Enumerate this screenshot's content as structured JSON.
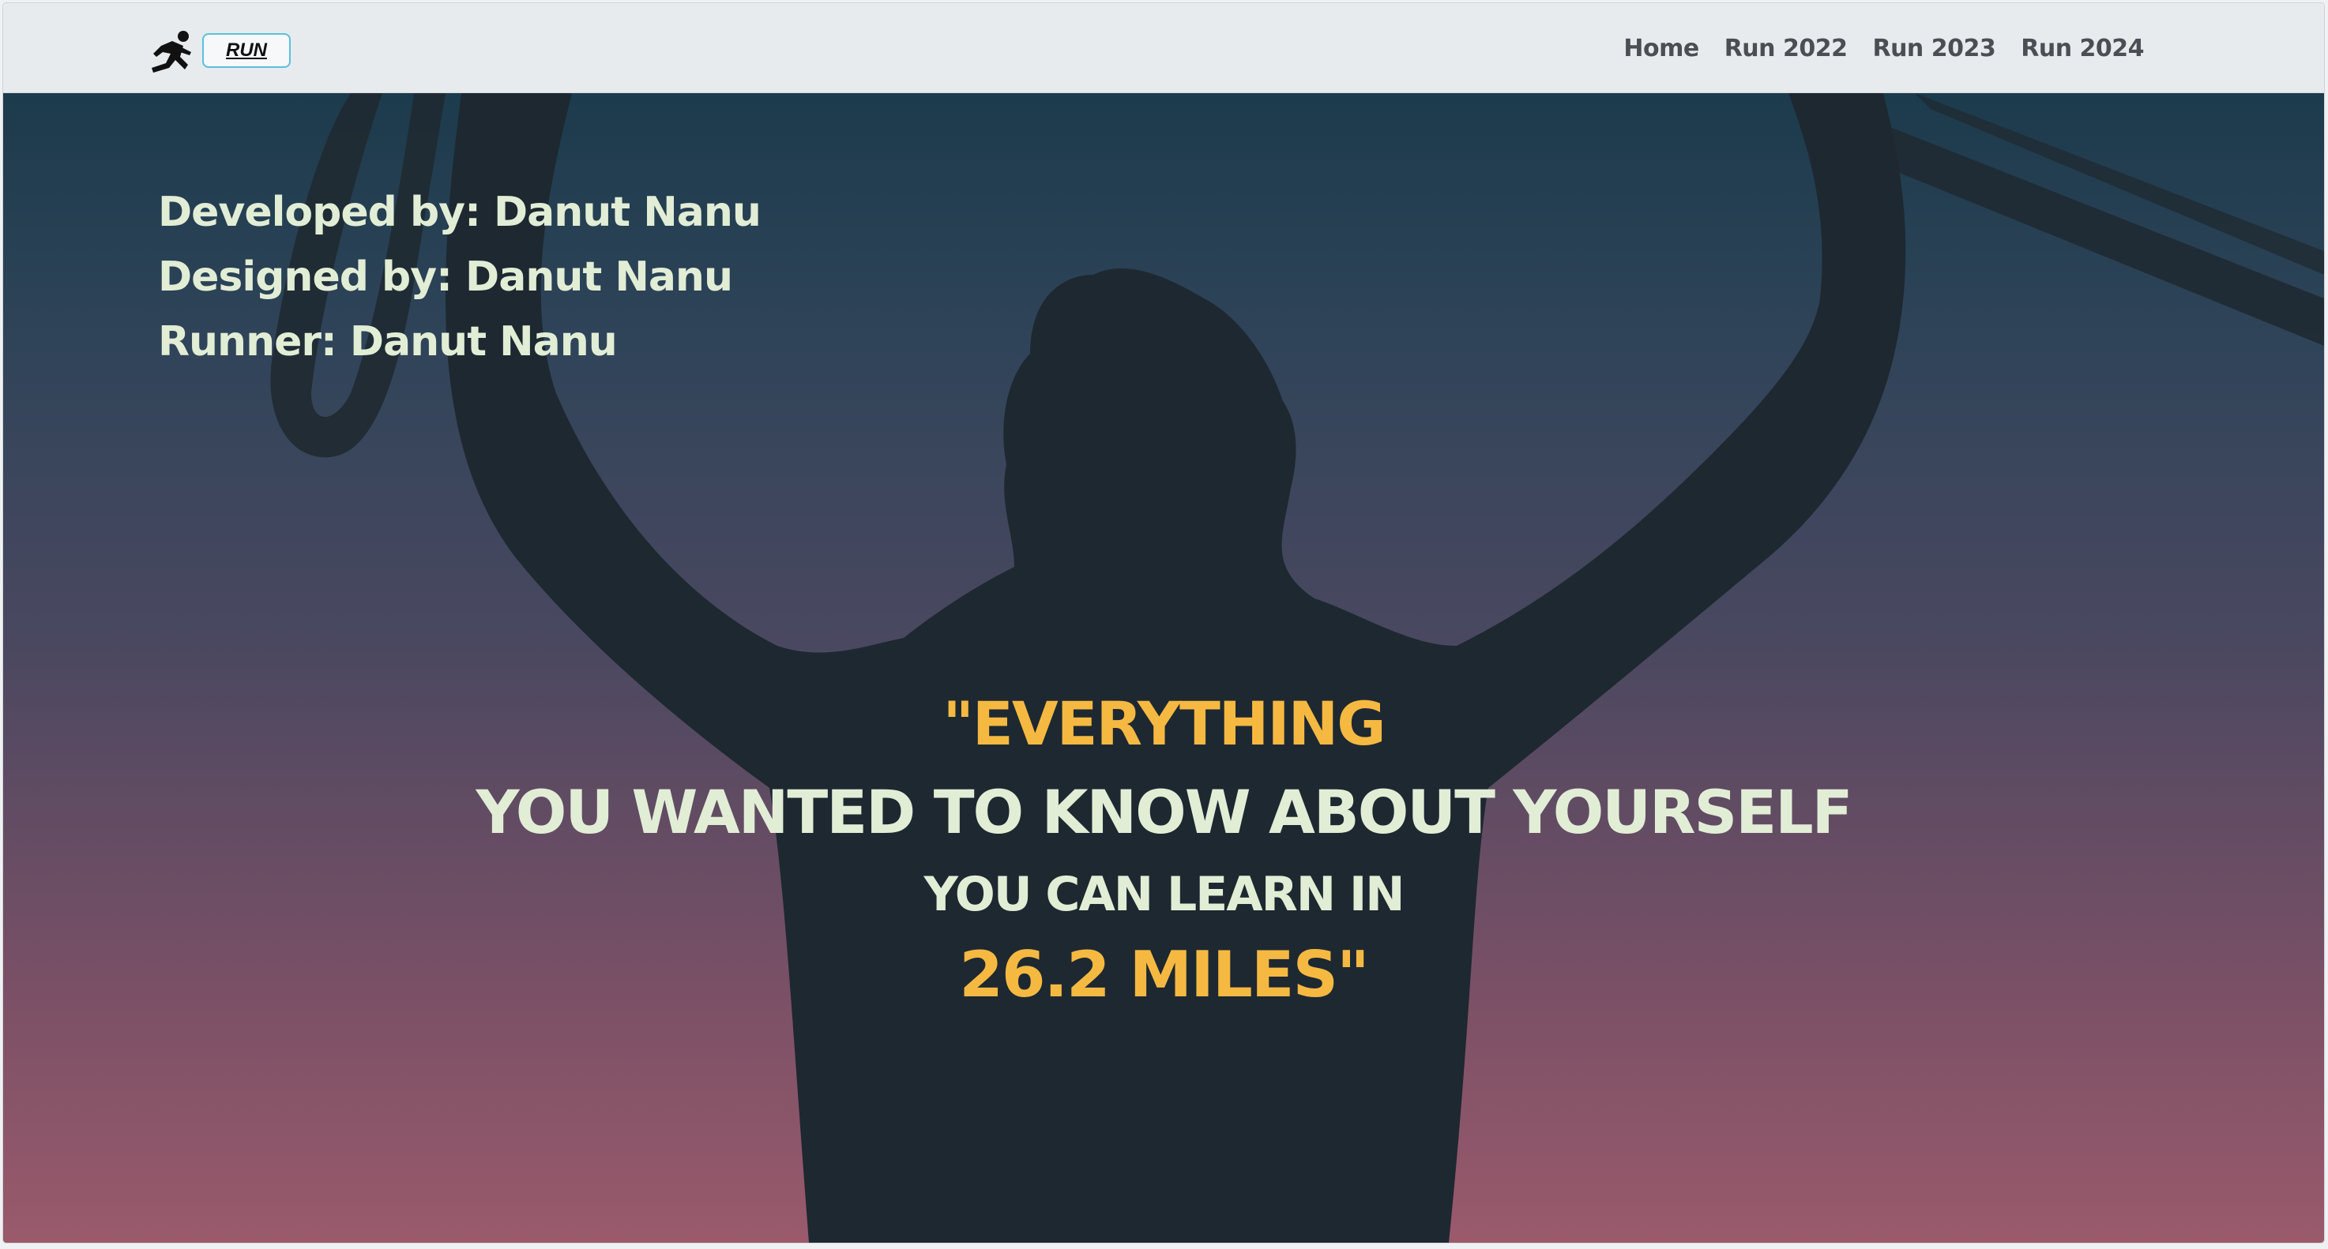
{
  "navbar": {
    "brand_icon": "running-person-icon",
    "brand_label": "RUN",
    "links": [
      "Home",
      "Run 2022",
      "Run 2023",
      "Run 2024"
    ]
  },
  "hero": {
    "credits": {
      "developed": "Developed by: Danut Nanu",
      "designed": "Designed by: Danut Nanu",
      "runner": "Runner: Danut Nanu"
    },
    "quote": {
      "line1": "\"EVERYTHING",
      "line2": "YOU WANTED TO KNOW ABOUT YOURSELF",
      "line3": "YOU CAN LEARN IN",
      "line4": "26.2 MILES\""
    }
  },
  "colors": {
    "accent": "#f5b942",
    "text_light": "#e2edd6",
    "navbar_bg": "#e8ebed",
    "badge_border": "#5bc0de"
  }
}
